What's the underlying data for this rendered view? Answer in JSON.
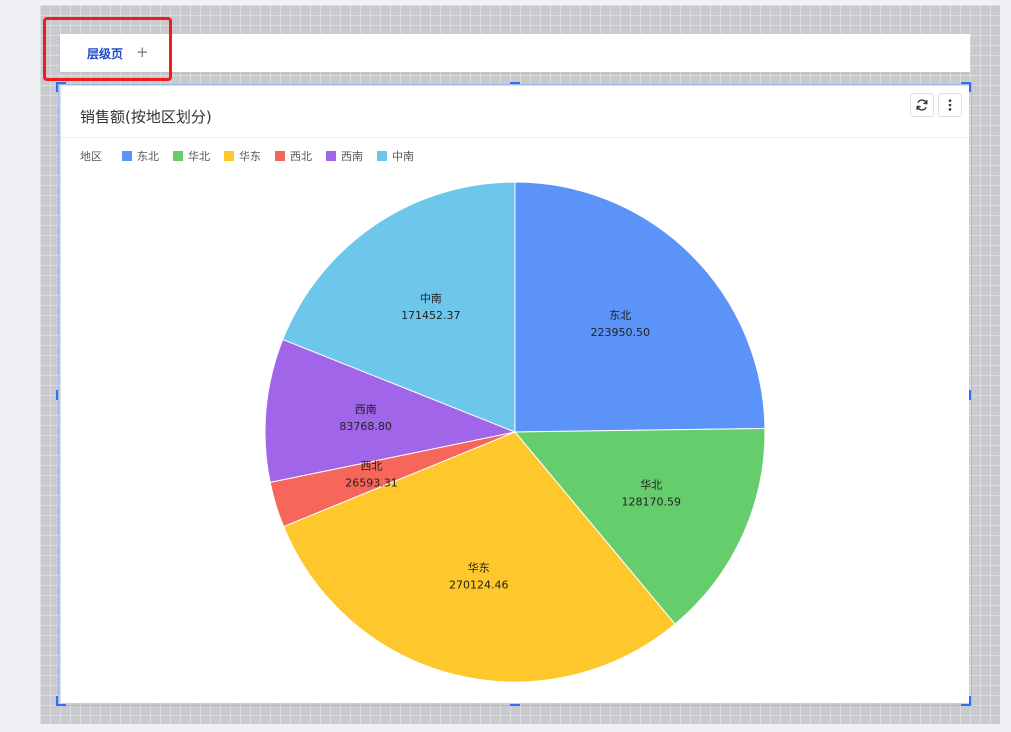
{
  "tabs": {
    "active_label": "层级页",
    "add_label": "+"
  },
  "panel": {
    "title": "销售额(按地区划分)",
    "refresh_icon": "refresh-icon",
    "more_icon": "more-vertical-icon"
  },
  "legend": {
    "title": "地区",
    "items": [
      {
        "label": "东北",
        "color": "#5b93f8"
      },
      {
        "label": "华北",
        "color": "#66cd6c"
      },
      {
        "label": "华东",
        "color": "#fec72c"
      },
      {
        "label": "西北",
        "color": "#f6665a"
      },
      {
        "label": "西南",
        "color": "#a065e9"
      },
      {
        "label": "中南",
        "color": "#6cc7eb"
      }
    ]
  },
  "chart_data": {
    "type": "pie",
    "title": "销售额(按地区划分)",
    "legend_title": "地区",
    "legend_position": "top-left",
    "categories": [
      "东北",
      "华北",
      "华东",
      "西北",
      "西南",
      "中南"
    ],
    "values": [
      223950.5,
      128170.59,
      270124.46,
      26593.31,
      83768.8,
      171452.37
    ],
    "value_labels": [
      "223950.50",
      "128170.59",
      "270124.46",
      "26593.31",
      "83768.80",
      "171452.37"
    ],
    "colors": [
      "#5b93f8",
      "#66cd6c",
      "#fec72c",
      "#f6665a",
      "#a065e9",
      "#6cc7eb"
    ]
  },
  "colors": {
    "accent": "#1f49c9",
    "highlight": "#f21b1b",
    "selection_handle": "#2f6ff0"
  }
}
